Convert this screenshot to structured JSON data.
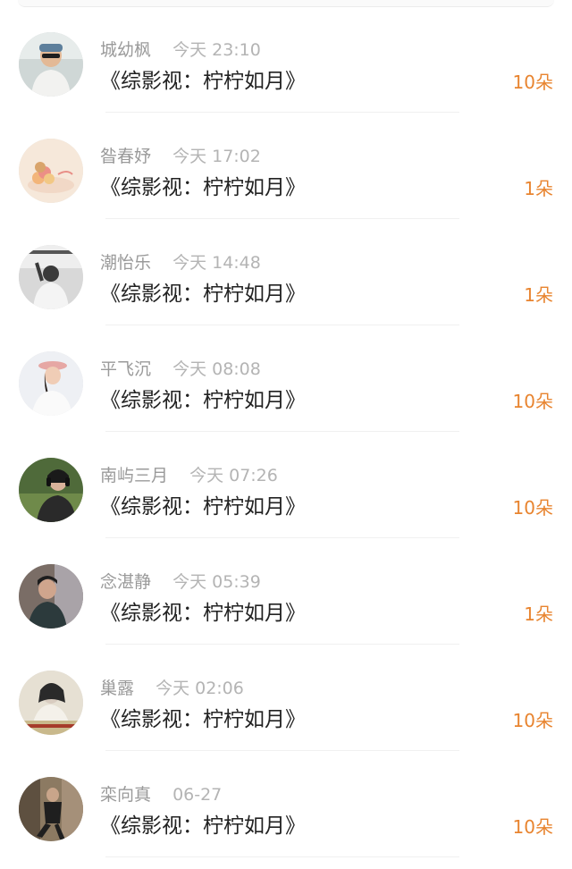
{
  "records": [
    {
      "name": "城幼枫",
      "time": "今天 23:10",
      "title": "《综影视：柠柠如月》",
      "amount": "10朵",
      "avatar": "avatar-man-sunglasses"
    },
    {
      "name": "昝春妤",
      "time": "今天 17:02",
      "title": "《综影视：柠柠如月》",
      "amount": "1朵",
      "avatar": "avatar-macarons"
    },
    {
      "name": "潮怡乐",
      "time": "今天 14:48",
      "title": "《综影视：柠柠如月》",
      "amount": "1朵",
      "avatar": "avatar-bw-man-back"
    },
    {
      "name": "平飞沉",
      "time": "今天 08:08",
      "title": "《综影视：柠柠如月》",
      "amount": "10朵",
      "avatar": "avatar-girl-hat"
    },
    {
      "name": "南屿三月",
      "time": "今天 07:26",
      "title": "《综影视：柠柠如月》",
      "amount": "10朵",
      "avatar": "avatar-girl-headphones"
    },
    {
      "name": "念湛静",
      "time": "今天 05:39",
      "title": "《综影视：柠柠如月》",
      "amount": "1朵",
      "avatar": "avatar-man-dark"
    },
    {
      "name": "巢露",
      "time": "今天 02:06",
      "title": "《综影视：柠柠如月》",
      "amount": "10朵",
      "avatar": "avatar-vintage-woman"
    },
    {
      "name": "栾向真",
      "time": "06-27",
      "title": "《综影视：柠柠如月》",
      "amount": "10朵",
      "avatar": "avatar-man-wall"
    }
  ]
}
